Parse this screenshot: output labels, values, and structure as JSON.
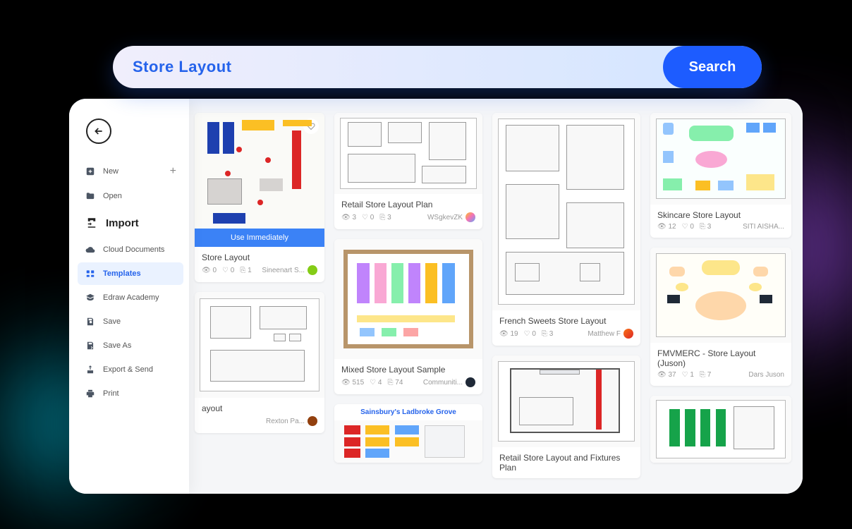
{
  "search": {
    "placeholder": "Store Layout",
    "value": "Store Layout",
    "button": "Search"
  },
  "sidebar": {
    "new": {
      "label": "New",
      "plus": "+"
    },
    "open": "Open",
    "import": "Import",
    "cloud": "Cloud Documents",
    "templates": "Templates",
    "academy": "Edraw Academy",
    "save": "Save",
    "saveAs": "Save As",
    "export": "Export & Send",
    "print": "Print"
  },
  "overlay": {
    "useImmediately": "Use Immediately"
  },
  "cards": {
    "c1": {
      "title": "Store Layout",
      "views": "0",
      "likes": "0",
      "copies": "1",
      "author": "Sineenart S..."
    },
    "c2": {
      "title": "ayout",
      "author": "Rexton Pa..."
    },
    "c3": {
      "title": "Retail Store Layout Plan",
      "views": "3",
      "likes": "0",
      "copies": "3",
      "author": "WSgkevZK"
    },
    "c4": {
      "title": "Mixed Store Layout Sample",
      "views": "515",
      "likes": "4",
      "copies": "74",
      "author": "Communiti..."
    },
    "c5": {
      "title": "Sainsbury's Ladbroke Grove"
    },
    "c6": {
      "title": "French Sweets Store Layout",
      "views": "19",
      "likes": "0",
      "copies": "3",
      "author": "Matthew F"
    },
    "c7": {
      "title": "Retail Store Layout and Fixtures Plan"
    },
    "c8": {
      "title": "Skincare Store Layout",
      "views": "12",
      "likes": "0",
      "copies": "3",
      "author": "SITI AISHA..."
    },
    "c9": {
      "title": "FMVMERC - Store Layout (Juson)",
      "views": "37",
      "likes": "1",
      "copies": "7",
      "author": "Dars Juson"
    }
  },
  "icons": {
    "eye": "👁",
    "heart": "♡",
    "copy": "⎘"
  },
  "colors": {
    "avatar_green": "#84cc16",
    "avatar_brown": "#92400e",
    "avatar_dark": "#1f2937",
    "avatar_rainbow": "linear-gradient(135deg,#fbbf24,#f472b6,#60a5fa)",
    "avatar_orange": "linear-gradient(135deg,#f97316,#dc2626)"
  }
}
